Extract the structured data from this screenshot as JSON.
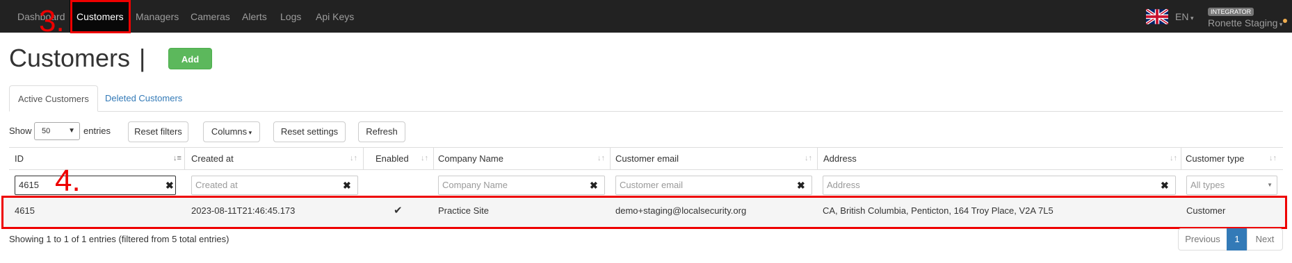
{
  "nav": {
    "items": [
      "Dashboard",
      "Customers",
      "Managers",
      "Cameras",
      "Alerts",
      "Logs",
      "Api Keys"
    ],
    "lang": "EN",
    "role_badge": "INTEGRATOR",
    "user": "Ronette Staging"
  },
  "annotations": {
    "step3": "3.",
    "step4": "4."
  },
  "page": {
    "title": "Customers",
    "separator": "|",
    "add_label": "Add"
  },
  "tabs": [
    "Active Customers",
    "Deleted Customers"
  ],
  "toolbar": {
    "show_label": "Show",
    "page_size": "50",
    "entries_label": "entries",
    "reset_filters": "Reset filters",
    "columns": "Columns",
    "reset_settings": "Reset settings",
    "refresh": "Refresh"
  },
  "table": {
    "headers": [
      "ID",
      "Created at",
      "Enabled",
      "Company Name",
      "Customer email",
      "Address",
      "Customer type"
    ],
    "filters": {
      "id_value": "4615",
      "created_placeholder": "Created at",
      "company_placeholder": "Company Name",
      "email_placeholder": "Customer email",
      "address_placeholder": "Address",
      "type_placeholder": "All types"
    },
    "rows": [
      {
        "id": "4615",
        "created_at": "2023-08-11T21:46:45.173",
        "enabled": "✔",
        "company": "Practice Site",
        "email": "demo+staging@localsecurity.org",
        "address": "CA, British Columbia, Penticton, 164 Troy Place, V2A 7L5",
        "type": "Customer"
      }
    ]
  },
  "footer": {
    "info": "Showing 1 to 1 of 1 entries (filtered from 5 total entries)",
    "previous": "Previous",
    "page": "1",
    "next": "Next"
  },
  "colors": {
    "navbar": "#222222",
    "add_button": "#5cb85c",
    "annotation": "#ee0000",
    "active_page": "#337ab7"
  }
}
